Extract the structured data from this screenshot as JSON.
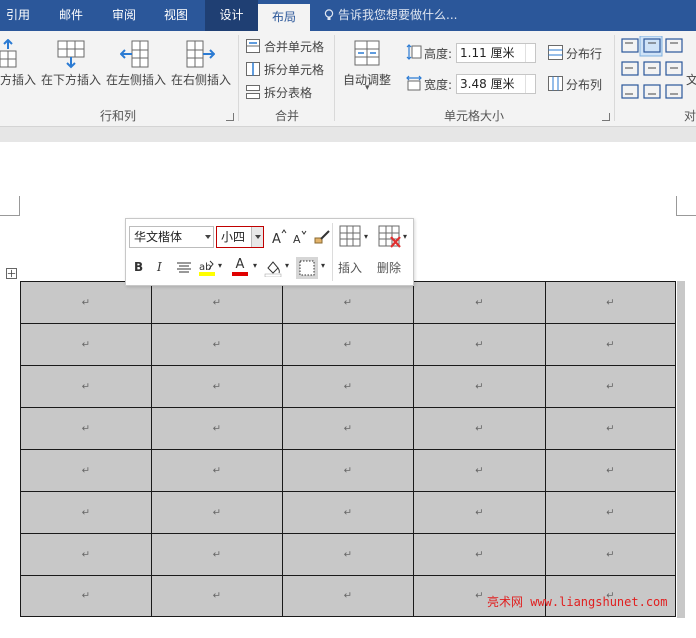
{
  "tabs": [
    {
      "label": "引用",
      "state": "normal"
    },
    {
      "label": "邮件",
      "state": "normal"
    },
    {
      "label": "审阅",
      "state": "normal"
    },
    {
      "label": "视图",
      "state": "normal"
    },
    {
      "label": "设计",
      "state": "context"
    },
    {
      "label": "布局",
      "state": "active"
    }
  ],
  "tell_me": "告诉我您想要做什么...",
  "rows_cols": {
    "group_label": "行和列",
    "insert_above": "方插入",
    "insert_below": "在下方插入",
    "insert_left": "在左侧插入",
    "insert_right": "在右侧插入"
  },
  "merge": {
    "group_label": "合并",
    "merge_cells": "合并单元格",
    "split_cells": "拆分单元格",
    "split_table": "拆分表格"
  },
  "cell_size": {
    "group_label": "单元格大小",
    "autofit": "自动调整",
    "height_label": "高度:",
    "height_value": "1.11 厘米",
    "width_label": "宽度:",
    "width_value": "3.48 厘米",
    "distribute_rows": "分布行",
    "distribute_cols": "分布列"
  },
  "alignment": {
    "group_label": "对齐",
    "text_dir": "文"
  },
  "mini_toolbar": {
    "font_name": "华文楷体",
    "font_size": "小四",
    "bold": "B",
    "italic": "I",
    "font_color_glyph": "A",
    "insert": "插入",
    "delete": "删除"
  },
  "cell_mark": "↵",
  "watermark": "亮术网 www.liangshunet.com",
  "colors": {
    "ribbon_blue": "#2b579a",
    "cell_gray": "#c8c8c8",
    "highlight_yellow": "#ffff00",
    "font_red": "#e00000",
    "font_size_border": "#c00000"
  }
}
